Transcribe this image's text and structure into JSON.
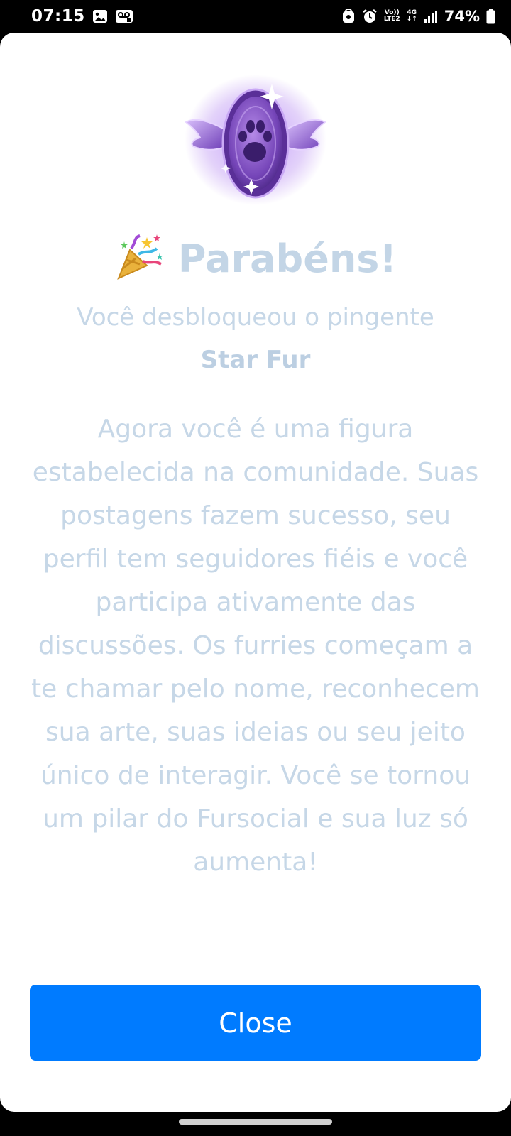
{
  "status_bar": {
    "time": "07:15",
    "network_top": "Vo))",
    "network_bottom": "LTE2",
    "data_type": "4G",
    "battery": "74%"
  },
  "dialog": {
    "title": "Parabéns!",
    "subtitle": "Você desbloqueou o pingente",
    "pendant_name": "Star Fur",
    "body": "Agora você é uma figura estabelecida na comunidade. Suas postagens fazem sucesso, seu perfil tem seguidores fiéis e você participa ativamente das discussões. Os furries começam a te chamar pelo nome, reconhecem sua arte, suas ideias ou seu jeito único de interagir. Você se tornou um pilar do Fursocial e sua luz só aumenta!",
    "close_label": "Close",
    "badge_icon": "winged-paw-pendant-icon",
    "title_icon": "party-popper-icon",
    "accent_color": "#007bff",
    "text_color": "#c6d7e7",
    "badge_color": "#7b4fc4"
  }
}
